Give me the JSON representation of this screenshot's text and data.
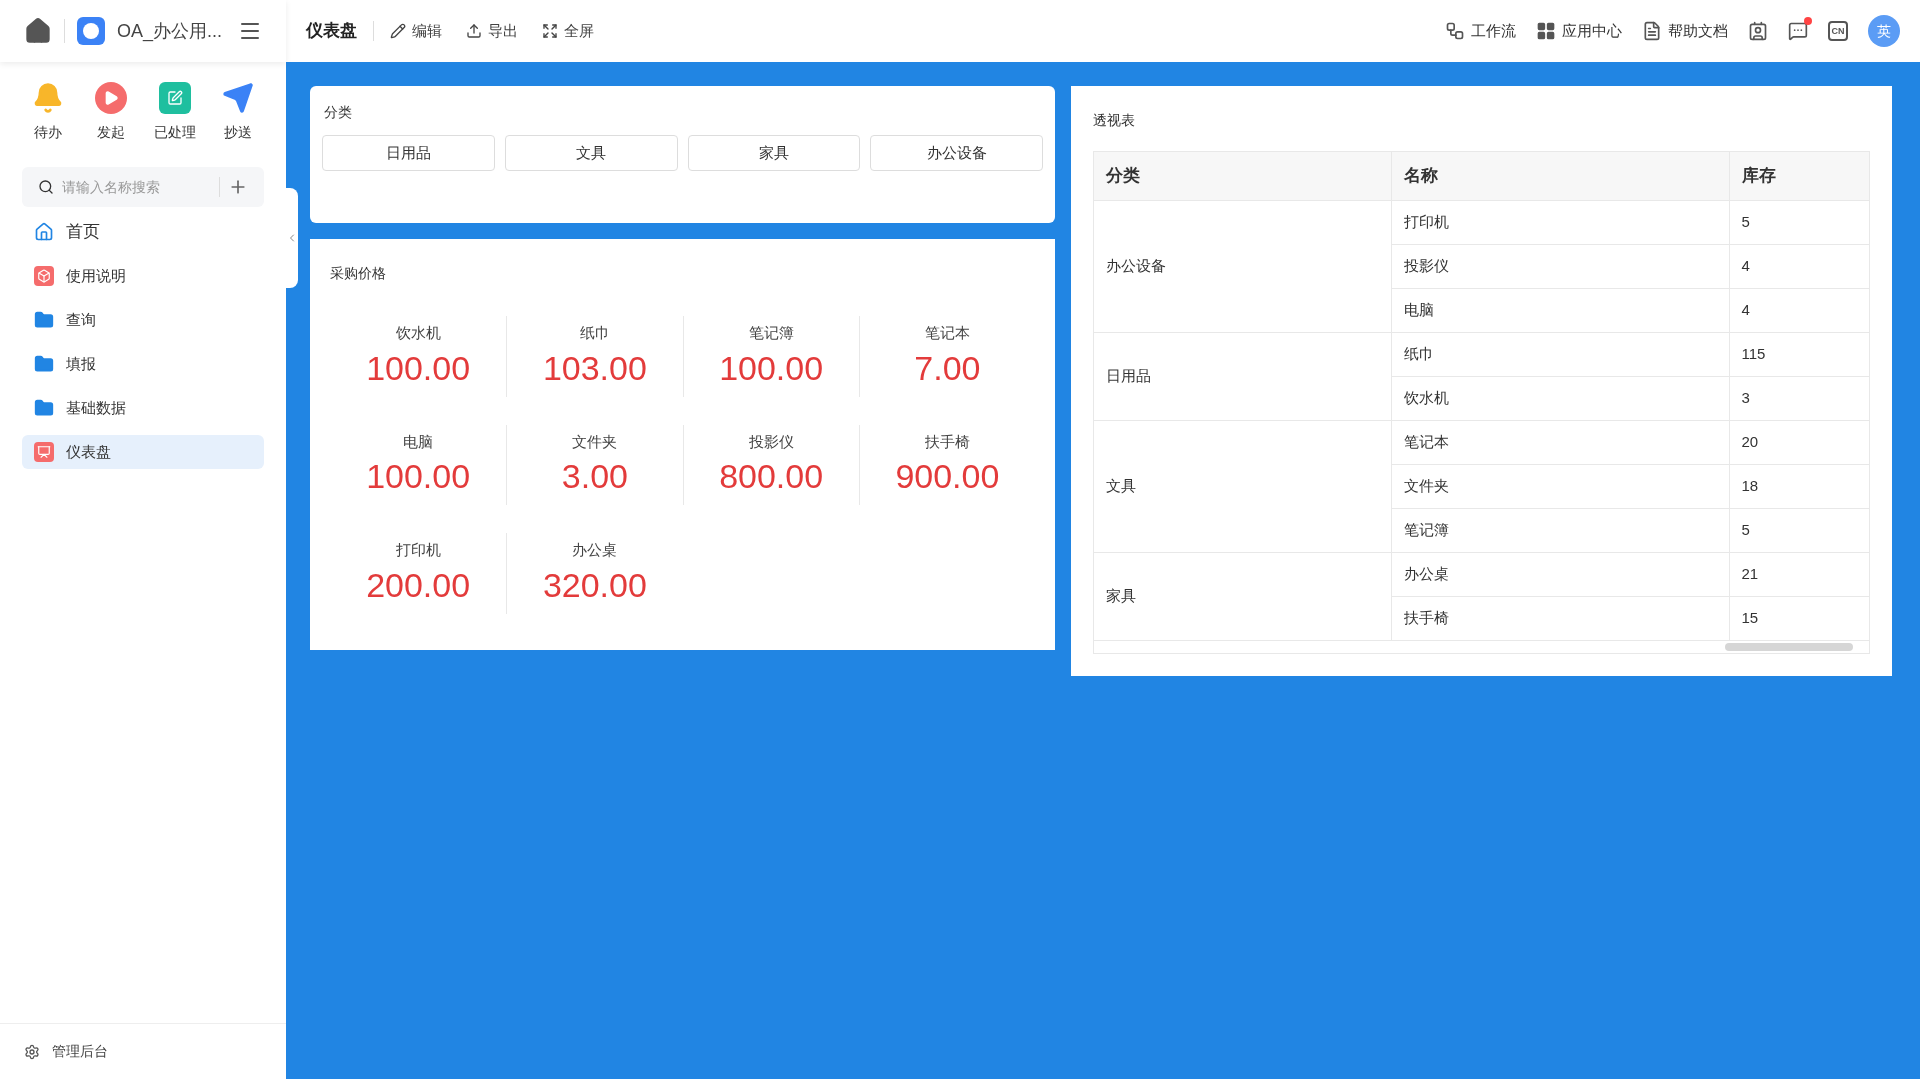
{
  "app": {
    "title": "OA_办公用..."
  },
  "quick_actions": [
    {
      "kind": "bell",
      "label": "待办"
    },
    {
      "kind": "play",
      "label": "发起"
    },
    {
      "kind": "done",
      "label": "已处理"
    },
    {
      "kind": "send",
      "label": "抄送"
    }
  ],
  "search": {
    "placeholder": "请输入名称搜索"
  },
  "sidebar": {
    "items": [
      {
        "kind": "home",
        "label": "首页",
        "selected": false
      },
      {
        "kind": "doc",
        "label": "使用说明",
        "selected": false
      },
      {
        "kind": "folder",
        "label": "查询",
        "selected": false
      },
      {
        "kind": "folder",
        "label": "填报",
        "selected": false
      },
      {
        "kind": "folder",
        "label": "基础数据",
        "selected": false
      },
      {
        "kind": "dashboard",
        "label": "仪表盘",
        "selected": true
      }
    ],
    "footer": "管理后台"
  },
  "toolbar": {
    "title": "仪表盘",
    "actions": [
      {
        "kind": "edit",
        "label": "编辑"
      },
      {
        "kind": "export",
        "label": "导出"
      },
      {
        "kind": "fullscreen",
        "label": "全屏"
      }
    ],
    "links": [
      {
        "kind": "workflow",
        "label": "工作流"
      },
      {
        "kind": "apps",
        "label": "应用中心"
      },
      {
        "kind": "docs",
        "label": "帮助文档"
      }
    ],
    "icons": [
      {
        "kind": "contacts",
        "badge": false
      },
      {
        "kind": "messages",
        "badge": true
      },
      {
        "kind": "lang",
        "text": "CN",
        "badge": false
      }
    ],
    "avatar": "英"
  },
  "filter": {
    "title": "分类",
    "options": [
      "日用品",
      "文具",
      "家具",
      "办公设备"
    ]
  },
  "prices": {
    "title": "采购价格",
    "items": [
      {
        "label": "饮水机",
        "value": "100.00"
      },
      {
        "label": "纸巾",
        "value": "103.00"
      },
      {
        "label": "笔记簿",
        "value": "100.00"
      },
      {
        "label": "笔记本",
        "value": "7.00"
      },
      {
        "label": "电脑",
        "value": "100.00"
      },
      {
        "label": "文件夹",
        "value": "3.00"
      },
      {
        "label": "投影仪",
        "value": "800.00"
      },
      {
        "label": "扶手椅",
        "value": "900.00"
      },
      {
        "label": "打印机",
        "value": "200.00"
      },
      {
        "label": "办公桌",
        "value": "320.00"
      }
    ]
  },
  "pivot": {
    "title": "透视表",
    "columns": [
      "分类",
      "名称",
      "库存"
    ],
    "groups": [
      {
        "category": "办公设备",
        "items": [
          {
            "name": "打印机",
            "stock": "5"
          },
          {
            "name": "投影仪",
            "stock": "4"
          },
          {
            "name": "电脑",
            "stock": "4"
          }
        ]
      },
      {
        "category": "日用品",
        "items": [
          {
            "name": "纸巾",
            "stock": "115"
          },
          {
            "name": "饮水机",
            "stock": "3"
          }
        ]
      },
      {
        "category": "文具",
        "items": [
          {
            "name": "笔记本",
            "stock": "20"
          },
          {
            "name": "文件夹",
            "stock": "18"
          },
          {
            "name": "笔记簿",
            "stock": "5"
          }
        ]
      },
      {
        "category": "家具",
        "items": [
          {
            "name": "办公桌",
            "stock": "21"
          },
          {
            "name": "扶手椅",
            "stock": "15"
          }
        ]
      }
    ]
  }
}
